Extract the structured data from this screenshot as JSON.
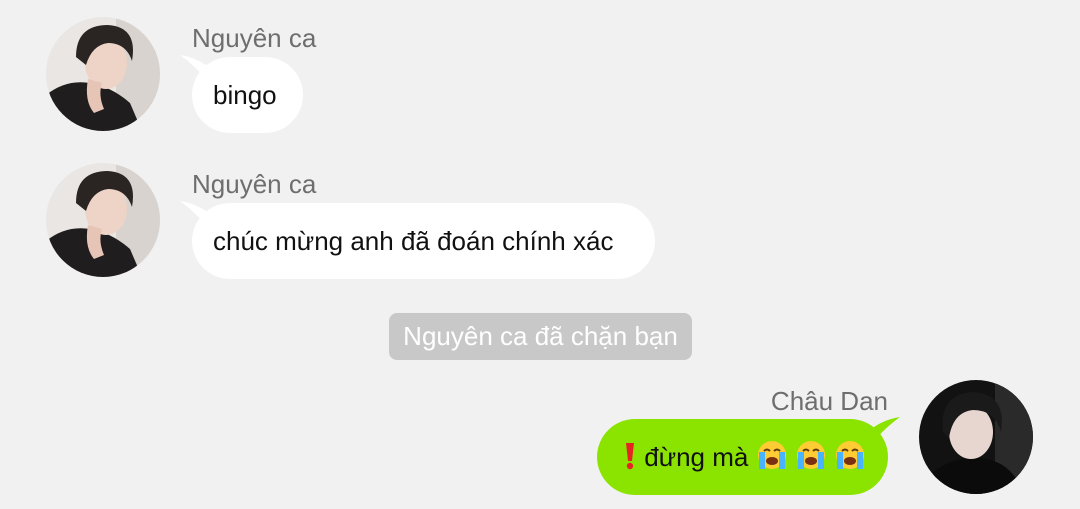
{
  "colors": {
    "background": "#f1f1f1",
    "incoming_bubble": "#ffffff",
    "outgoing_bubble": "#8be400",
    "sender_name": "#6e6e6e",
    "system_notice_bg": "#c8c8c8",
    "system_notice_text": "#ffffff"
  },
  "messages": [
    {
      "direction": "incoming",
      "sender": "Nguyên ca",
      "avatar_icon": "user-photo-avatar",
      "text": "bingo"
    },
    {
      "direction": "incoming",
      "sender": "Nguyên ca",
      "avatar_icon": "user-photo-avatar",
      "text": "chúc mừng anh đã đoán chính xác"
    },
    {
      "direction": "outgoing",
      "sender": "Châu Dan",
      "avatar_icon": "user-photo-avatar",
      "text": "đừng mà",
      "icons": [
        "exclamation-icon",
        "loudly-crying-face-emoji",
        "loudly-crying-face-emoji",
        "loudly-crying-face-emoji"
      ]
    }
  ],
  "system_notice": {
    "text": "Nguyên ca đã chặn bạn"
  }
}
